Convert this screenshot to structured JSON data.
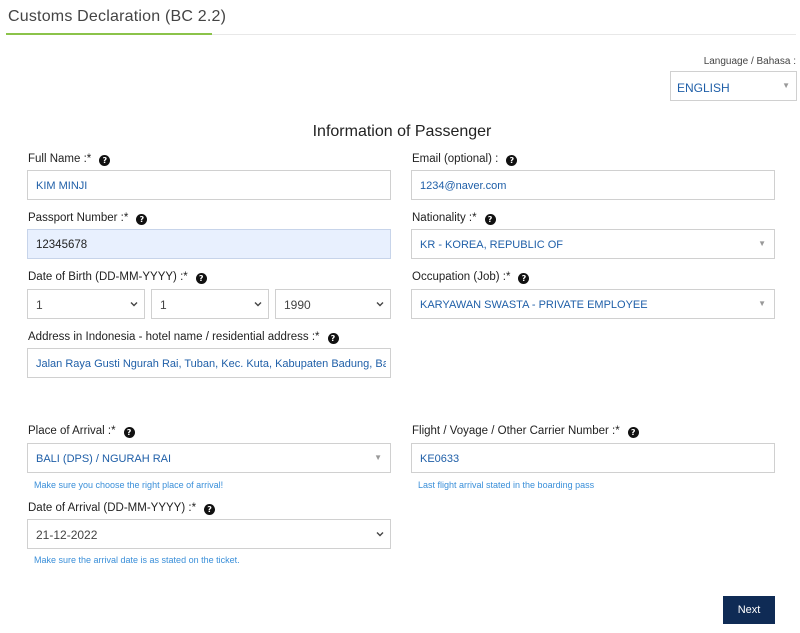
{
  "header": {
    "title": "Customs Declaration (BC 2.2)"
  },
  "language": {
    "label": "Language / Bahasa :",
    "value": "ENGLISH"
  },
  "section_title": "Information of Passenger",
  "help_glyph": "?",
  "fields": {
    "full_name": {
      "label": "Full Name :*",
      "value": "KIM MINJI"
    },
    "email": {
      "label": "Email (optional) :",
      "value": "1234@naver.com"
    },
    "passport": {
      "label": "Passport Number :*",
      "value": "12345678"
    },
    "nationality": {
      "label": "Nationality :*",
      "value": "KR - KOREA, REPUBLIC OF"
    },
    "dob": {
      "label": "Date of Birth (DD-MM-YYYY) :*",
      "day": "1",
      "month": "1",
      "year": "1990"
    },
    "occupation": {
      "label": "Occupation (Job) :*",
      "value": "KARYAWAN SWASTA - PRIVATE EMPLOYEE"
    },
    "address": {
      "label": "Address in Indonesia - hotel name / residential address :*",
      "value": "Jalan Raya Gusti Ngurah Rai, Tuban, Kec. Kuta, Kabupaten Badung, Bali"
    },
    "place_of_arrival": {
      "label": "Place of Arrival :*",
      "value": "BALI (DPS) / NGURAH RAI",
      "hint": "Make sure you choose the right place of arrival!"
    },
    "flight": {
      "label": "Flight / Voyage / Other Carrier Number :*",
      "value": "KE0633",
      "hint": "Last flight arrival stated in the boarding pass"
    },
    "date_of_arrival": {
      "label": "Date of Arrival (DD-MM-YYYY) :*",
      "value": "21-12-2022",
      "hint": "Make sure the arrival date is as stated on the ticket."
    }
  },
  "buttons": {
    "next": "Next"
  },
  "colors": {
    "accent_green": "#8bc34a",
    "value_blue": "#1f5fa8",
    "hint_blue": "#3a8fd9",
    "button_navy": "#0f2b55",
    "autofill_bg": "#e8f0fe"
  }
}
